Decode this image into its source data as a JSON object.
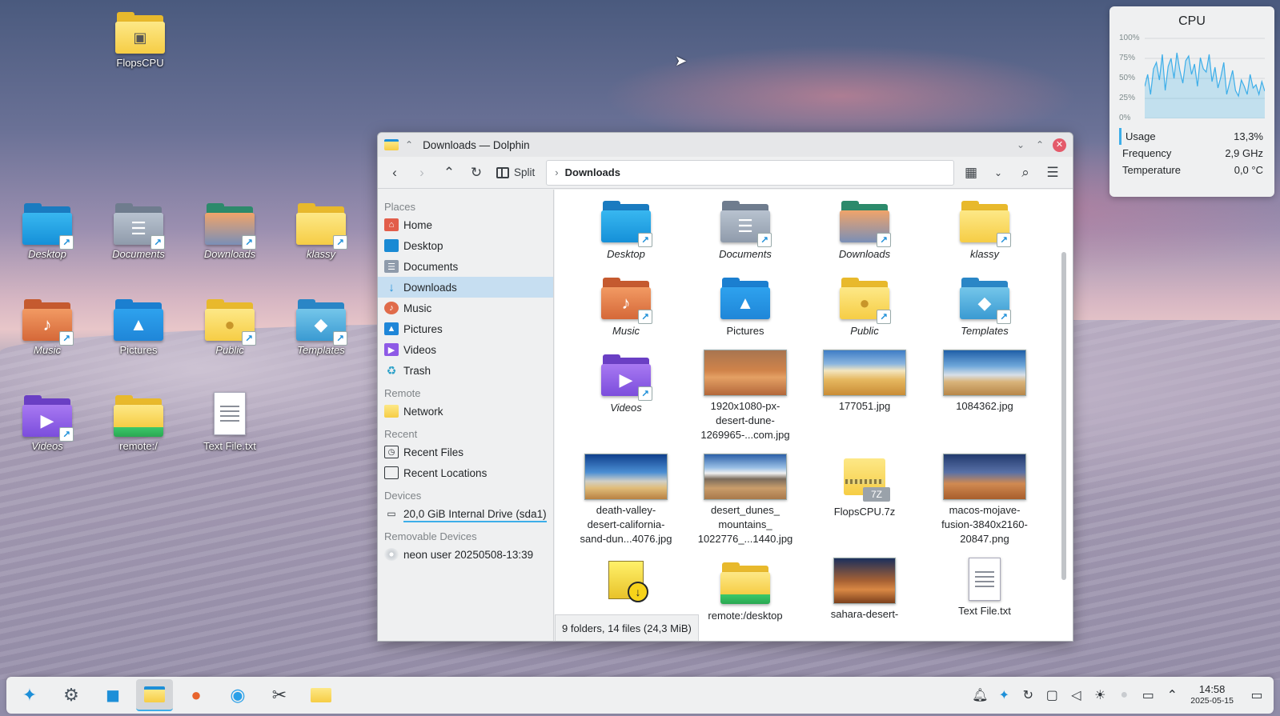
{
  "desktop": {
    "icons": [
      {
        "name": "FlopsCPU",
        "italic": false
      },
      {
        "name": "Desktop",
        "italic": true
      },
      {
        "name": "Documents",
        "italic": true
      },
      {
        "name": "Downloads",
        "italic": true
      },
      {
        "name": "klassy",
        "italic": true
      },
      {
        "name": "Music",
        "italic": true
      },
      {
        "name": "Pictures",
        "italic": false
      },
      {
        "name": "Public",
        "italic": true
      },
      {
        "name": "Templates",
        "italic": true
      },
      {
        "name": "Videos",
        "italic": true
      },
      {
        "name": "remote:/",
        "italic": false
      },
      {
        "name": "Text File.txt",
        "italic": false
      }
    ]
  },
  "cpu_widget": {
    "title": "CPU",
    "y_ticks": [
      "100%",
      "75%",
      "50%",
      "25%",
      "0%"
    ],
    "usage_series": [
      40,
      55,
      30,
      62,
      70,
      48,
      80,
      35,
      65,
      75,
      50,
      82,
      60,
      44,
      72,
      78,
      55,
      68,
      40,
      76,
      62,
      58,
      80,
      46,
      64,
      38,
      52,
      70,
      30,
      45,
      60,
      35,
      28,
      48,
      40,
      30,
      55,
      38,
      42,
      30,
      46,
      34
    ],
    "rows": [
      {
        "label": "Usage",
        "value": "13,3%"
      },
      {
        "label": "Frequency",
        "value": "2,9 GHz"
      },
      {
        "label": "Temperature",
        "value": "0,0 °C"
      }
    ],
    "accent": "#3daee9"
  },
  "window": {
    "title": "Downloads — Dolphin",
    "toolbar": {
      "split_label": "Split",
      "breadcrumb": "Downloads"
    },
    "sidebar": {
      "sections": {
        "places": "Places",
        "remote": "Remote",
        "recent": "Recent",
        "devices": "Devices",
        "removable": "Removable Devices"
      },
      "places": [
        {
          "label": "Home",
          "icon": "home-icon"
        },
        {
          "label": "Desktop",
          "icon": "desktop-icon"
        },
        {
          "label": "Documents",
          "icon": "documents-icon"
        },
        {
          "label": "Downloads",
          "icon": "downloads-icon",
          "active": true
        },
        {
          "label": "Music",
          "icon": "music-icon"
        },
        {
          "label": "Pictures",
          "icon": "pictures-icon"
        },
        {
          "label": "Videos",
          "icon": "videos-icon"
        },
        {
          "label": "Trash",
          "icon": "trash-icon"
        }
      ],
      "remote": [
        {
          "label": "Network",
          "icon": "network-icon"
        }
      ],
      "recent": [
        {
          "label": "Recent Files",
          "icon": "recent-files-icon"
        },
        {
          "label": "Recent Locations",
          "icon": "recent-locations-icon"
        }
      ],
      "devices": [
        {
          "label": "20,0 GiB Internal Drive (sda1)",
          "icon": "drive-icon"
        }
      ],
      "removable": [
        {
          "label": "neon user 20250508-13:39",
          "icon": "optical-disc-icon"
        }
      ]
    },
    "files": [
      {
        "name": "Desktop",
        "italic": true
      },
      {
        "name": "Documents",
        "italic": true
      },
      {
        "name": "Downloads",
        "italic": true
      },
      {
        "name": "klassy",
        "italic": true
      },
      {
        "name": "Music",
        "italic": true
      },
      {
        "name": "Pictures",
        "italic": false
      },
      {
        "name": "Public",
        "italic": true
      },
      {
        "name": "Templates",
        "italic": true
      },
      {
        "name": "Videos",
        "italic": true
      },
      {
        "name": "1920x1080-px-\ndesert-dune-\n1269965-...com.jpg",
        "italic": false
      },
      {
        "name": "177051.jpg",
        "italic": false
      },
      {
        "name": "1084362.jpg",
        "italic": false
      },
      {
        "name": "death-valley-\ndesert-california-\nsand-dun...4076.jpg",
        "italic": false
      },
      {
        "name": "desert_dunes_\nmountains_\n1022776_...1440.jpg",
        "italic": false
      },
      {
        "name": "FlopsCPU.7z",
        "italic": false
      },
      {
        "name": "macos-mojave-\nfusion-3840x2160-\n20847.png",
        "italic": false
      },
      {
        "name": "",
        "italic": false
      },
      {
        "name": "remote:/desktop",
        "italic": false
      },
      {
        "name": "sahara-desert-",
        "italic": false
      },
      {
        "name": "Text File.txt",
        "italic": false
      }
    ],
    "archive_tag": "7Z",
    "status": "9 folders, 14 files (24,3 MiB)"
  },
  "taskbar": {
    "apps": [
      "launcher-icon",
      "settings-icon",
      "discover-icon",
      "dolphin-icon",
      "firefox-icon",
      "kdeconnect-icon",
      "spectacle-icon",
      "file-manager-icon"
    ],
    "tray": [
      "notifications-icon",
      "kdeconnect-tray-icon",
      "updates-icon",
      "clipboard-icon",
      "volume-icon",
      "brightness-icon",
      "night-light-icon",
      "display-icon",
      "expand-tray-icon"
    ],
    "time": "14:58",
    "date": "2025-05-15"
  }
}
